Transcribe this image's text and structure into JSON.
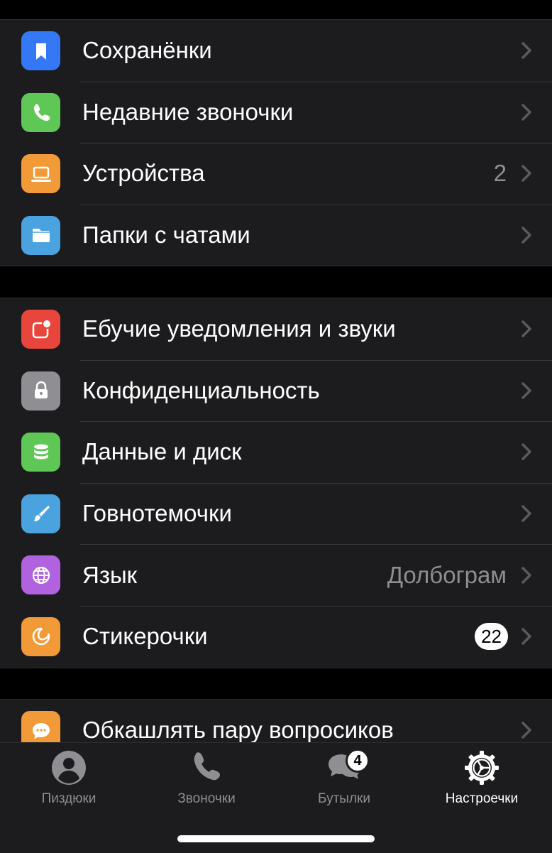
{
  "settings": {
    "group1": [
      {
        "label": "Сохранёнки",
        "icon": "bookmark-icon",
        "color": "#3478f6",
        "value": ""
      },
      {
        "label": "Недавние звоночки",
        "icon": "phone-icon",
        "color": "#5fc755",
        "value": ""
      },
      {
        "label": "Устройства",
        "icon": "laptop-icon",
        "color": "#f29a38",
        "value": "2"
      },
      {
        "label": "Папки с чатами",
        "icon": "folder-icon",
        "color": "#4aa3df",
        "value": ""
      }
    ],
    "group2": [
      {
        "label": "Ебучие уведомления и звуки",
        "icon": "notification-icon",
        "color": "#e8463c",
        "value": ""
      },
      {
        "label": "Конфиденциальность",
        "icon": "lock-icon",
        "color": "#8e8e93",
        "value": ""
      },
      {
        "label": "Данные и диск",
        "icon": "database-icon",
        "color": "#5fc755",
        "value": ""
      },
      {
        "label": "Говнотемочки",
        "icon": "brush-icon",
        "color": "#4aa3df",
        "value": ""
      },
      {
        "label": "Язык",
        "icon": "globe-icon",
        "color": "#b062df",
        "value": "Долбограм"
      },
      {
        "label": "Стикерочки",
        "icon": "sticker-icon",
        "color": "#f29a38",
        "badge": "22"
      }
    ],
    "group3": [
      {
        "label": "Обкашлять пару вопросиков",
        "icon": "chat-bubble-icon",
        "color": "#f29a38",
        "value": ""
      }
    ]
  },
  "tabbar": {
    "tabs": [
      {
        "label": "Пиздюки",
        "icon": "person-icon",
        "active": false
      },
      {
        "label": "Звоночки",
        "icon": "phone-icon",
        "active": false
      },
      {
        "label": "Бутылки",
        "icon": "chats-icon",
        "active": false,
        "badge": "4"
      },
      {
        "label": "Настроечки",
        "icon": "settings-gear-icon",
        "active": true
      }
    ]
  },
  "colors": {
    "background": "#000000",
    "cell": "#1c1c1e",
    "separator": "#38383a",
    "secondary_text": "#8e8e93"
  }
}
